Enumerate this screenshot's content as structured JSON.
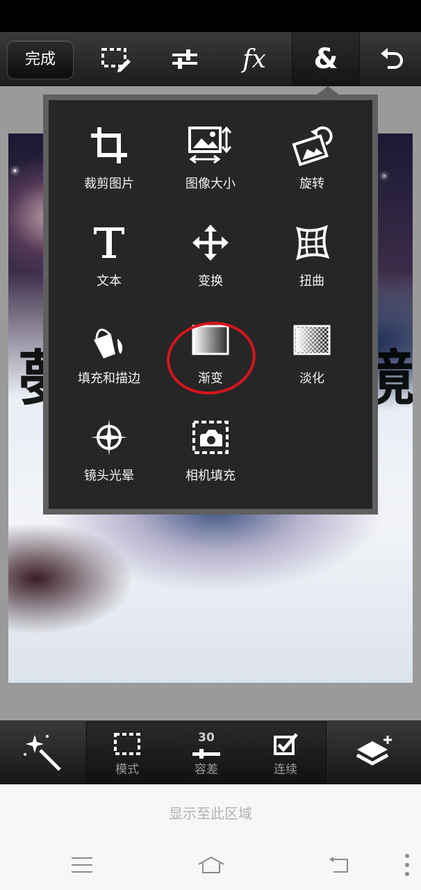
{
  "toolbar": {
    "done_label": "完成",
    "icons": [
      "selection-edit-icon",
      "adjust-sliders-icon",
      "fx-icon",
      "ampersand-icon",
      "undo-icon"
    ],
    "fx_text": "fx",
    "amp_text": "&"
  },
  "menu": {
    "items": [
      {
        "label": "裁剪图片",
        "icon": "crop-icon"
      },
      {
        "label": "图像大小",
        "icon": "image-size-icon"
      },
      {
        "label": "旋转",
        "icon": "rotate-icon"
      },
      {
        "label": "文本",
        "icon": "text-icon"
      },
      {
        "label": "变换",
        "icon": "move-arrows-icon"
      },
      {
        "label": "扭曲",
        "icon": "warp-grid-icon"
      },
      {
        "label": "填充和描边",
        "icon": "paint-bucket-icon"
      },
      {
        "label": "渐变",
        "icon": "gradient-icon"
      },
      {
        "label": "淡化",
        "icon": "fade-icon"
      },
      {
        "label": "镜头光晕",
        "icon": "lens-flare-icon"
      },
      {
        "label": "相机填充",
        "icon": "camera-fill-icon"
      }
    ],
    "annotation_color": "#d8141d"
  },
  "bottom_toolbar": {
    "magic_wand_icon": "magic-wand-icon",
    "mode_label": "模式",
    "tolerance_value": "30",
    "tolerance_label": "容差",
    "continuous_label": "连续",
    "layers_icon": "layers-add-icon"
  },
  "system": {
    "hint_text": "显示至此区域",
    "nav": [
      "menu-icon",
      "home-icon",
      "back-icon",
      "more-icon"
    ]
  }
}
